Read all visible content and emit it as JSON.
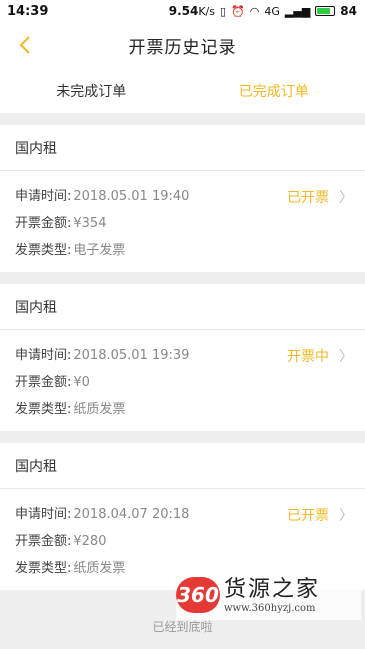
{
  "statusbar": {
    "time": "14:39",
    "network_speed": "9.54",
    "network_unit": "K/s",
    "signal_label": "4G",
    "battery": "84"
  },
  "navbar": {
    "title": "开票历史记录",
    "back_icon": "chevron-left-icon"
  },
  "tabs": [
    {
      "label": "未完成订单",
      "active": false
    },
    {
      "label": "已完成订单",
      "active": true
    }
  ],
  "labels": {
    "time": "申请时间:",
    "amount": "开票金额:",
    "type": "发票类型:"
  },
  "orders": [
    {
      "category": "国内租",
      "time": "2018.05.01 19:40",
      "amount": "¥354",
      "invoice_type": "电子发票",
      "status": "已开票"
    },
    {
      "category": "国内租",
      "time": "2018.05.01 19:39",
      "amount": "¥0",
      "invoice_type": "纸质发票",
      "status": "开票中"
    },
    {
      "category": "国内租",
      "time": "2018.04.07 20:18",
      "amount": "¥280",
      "invoice_type": "纸质发票",
      "status": "已开票"
    }
  ],
  "footer": {
    "text": "已经到底啦"
  },
  "watermark": {
    "logo": "360",
    "name": "货源之家",
    "url": "www.360hyzj.com"
  },
  "colors": {
    "accent": "#f2b824",
    "background": "#eeeeee"
  }
}
